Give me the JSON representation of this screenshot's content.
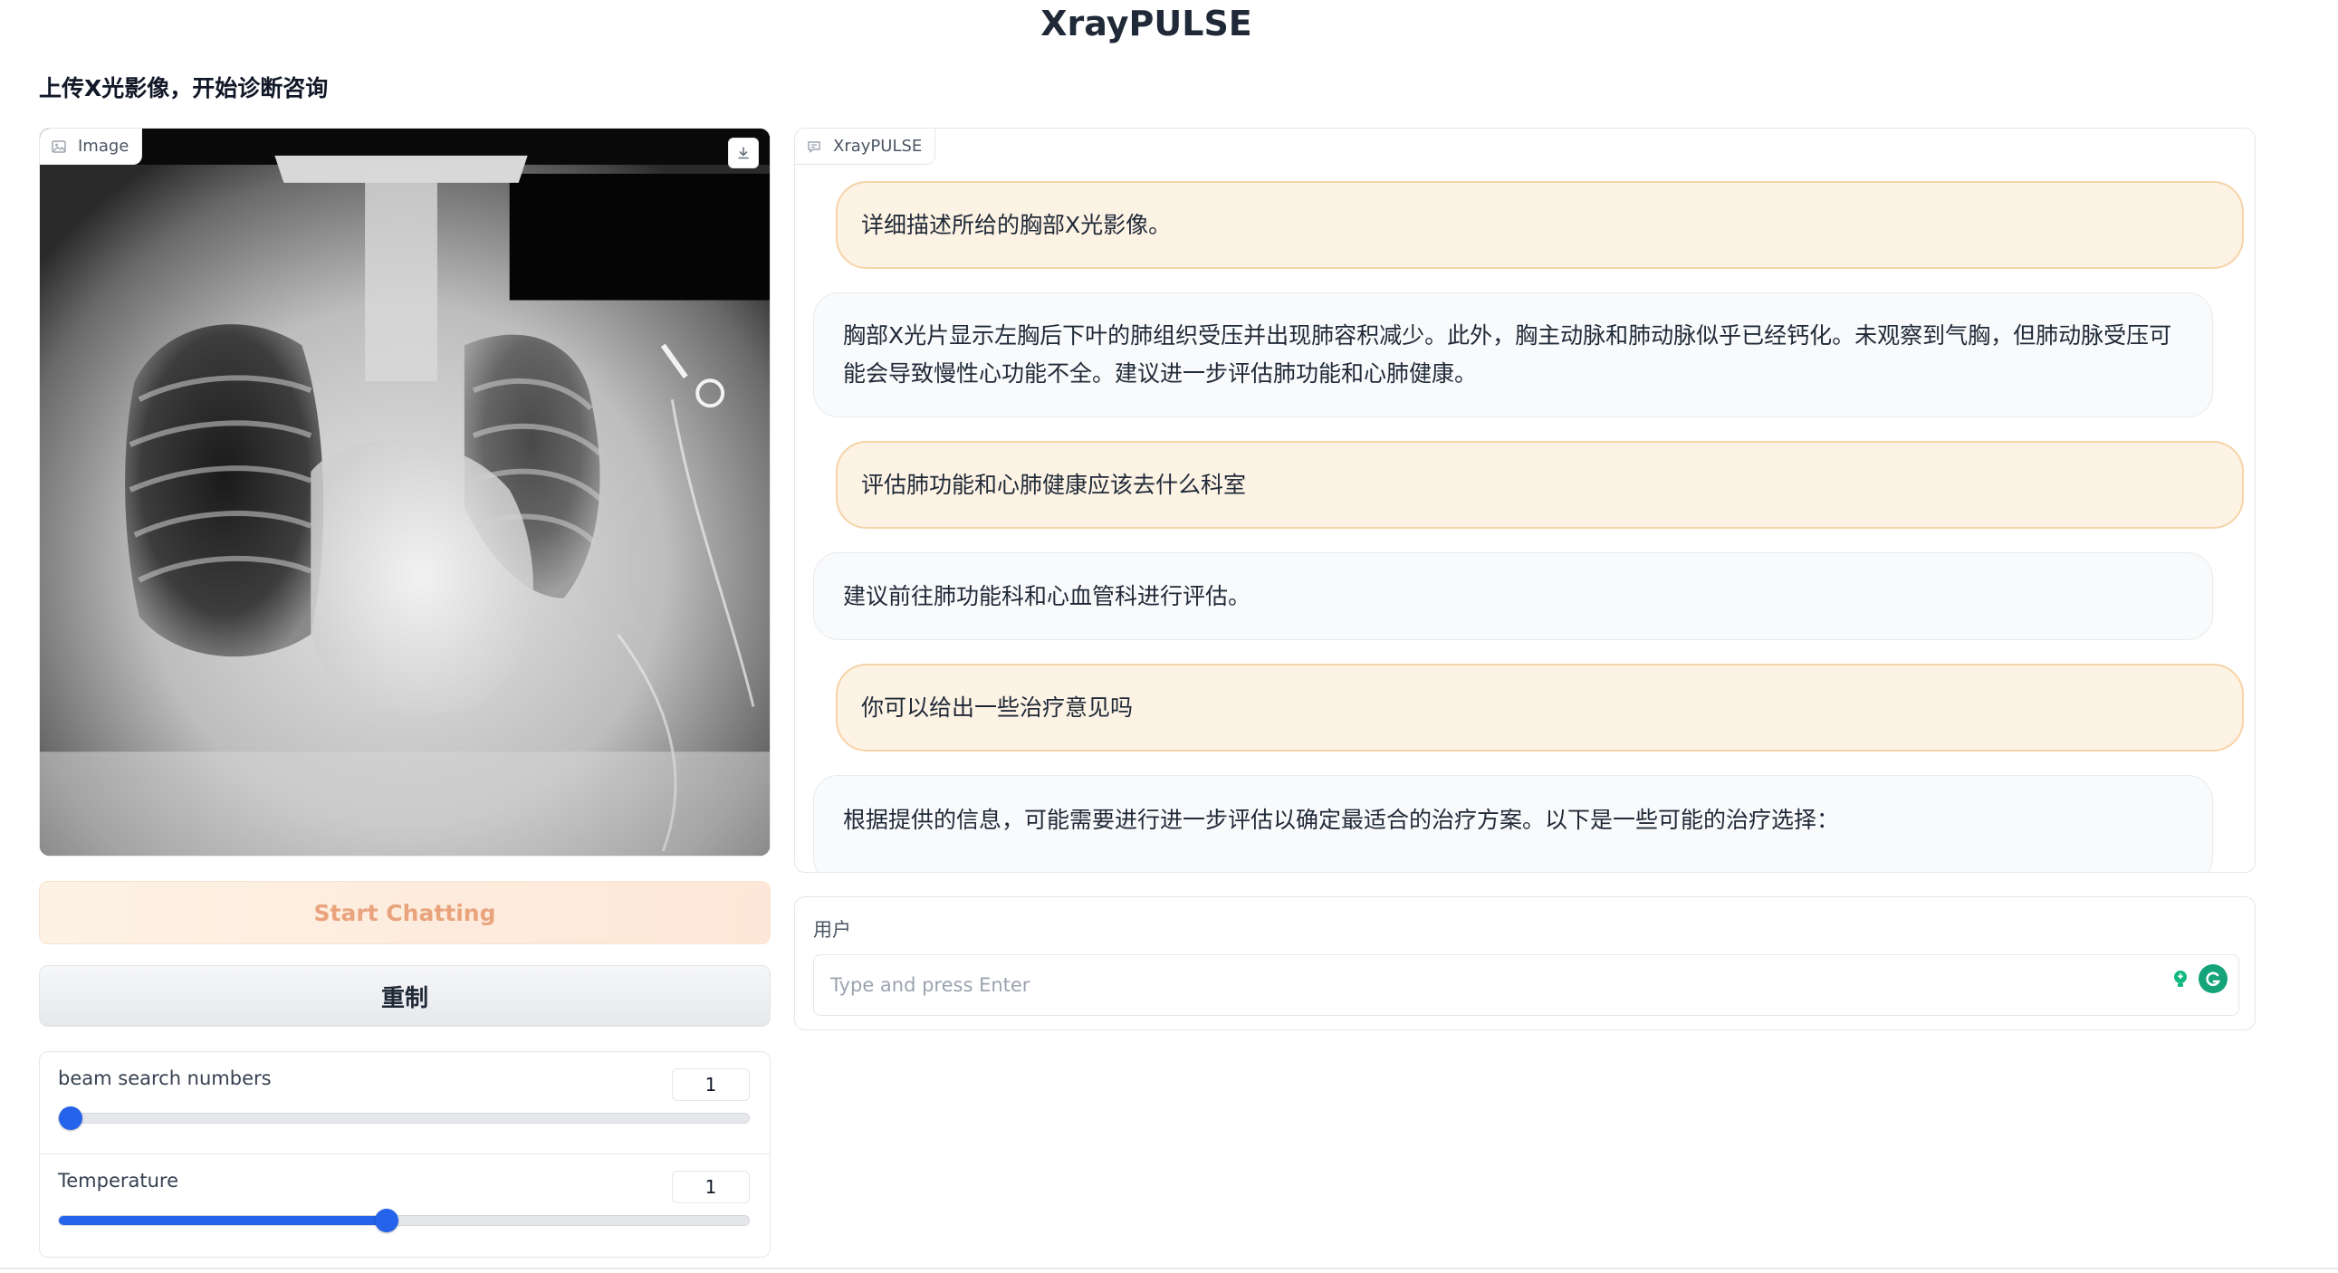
{
  "app": {
    "title": "XrayPULSE",
    "subtitle": "上传X光影像，开始诊断咨询"
  },
  "image_panel": {
    "label": "Image"
  },
  "buttons": {
    "start": "Start Chatting",
    "reset": "重制"
  },
  "sliders": [
    {
      "label": "beam search numbers",
      "value": "1",
      "fraction": 0.0
    },
    {
      "label": "Temperature",
      "value": "1",
      "fraction": 0.475
    }
  ],
  "chat": {
    "label": "XrayPULSE",
    "messages": [
      {
        "role": "user",
        "text": "详细描述所给的胸部X光影像。"
      },
      {
        "role": "bot",
        "text": "胸部X光片显示左胸后下叶的肺组织受压并出现肺容积减少。此外，胸主动脉和肺动脉似乎已经钙化。未观察到气胸，但肺动脉受压可能会导致慢性心功能不全。建议进一步评估肺功能和心肺健康。"
      },
      {
        "role": "user",
        "text": "评估肺功能和心肺健康应该去什么科室"
      },
      {
        "role": "bot",
        "text": "建议前往肺功能科和心血管科进行评估。"
      },
      {
        "role": "user",
        "text": "你可以给出一些治疗意见吗"
      },
      {
        "role": "bot",
        "text": "根据提供的信息，可能需要进行进一步评估以确定最适合的治疗方案。以下是一些可能的治疗选择："
      }
    ]
  },
  "input": {
    "label": "用户",
    "placeholder": "Type and press Enter",
    "value": ""
  },
  "colors": {
    "accent": "#2563eb",
    "user_bubble": "#fdf3e4",
    "user_border": "#f6d3a8",
    "start_text": "#e9a37d"
  }
}
